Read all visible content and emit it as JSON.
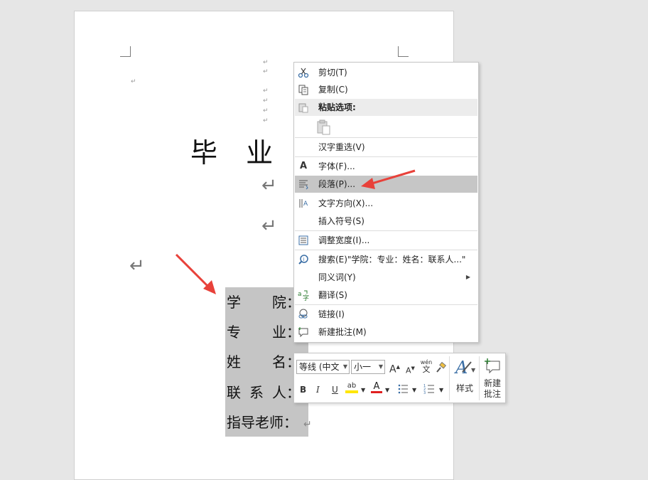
{
  "document": {
    "title": "毕 业 论",
    "return_mark": "↵",
    "fields": [
      {
        "label": "学院",
        "sep": "："
      },
      {
        "label": "专业",
        "sep": "："
      },
      {
        "label": "姓名",
        "sep": "："
      },
      {
        "label": "联系人",
        "sep": "："
      },
      {
        "label": "指导老师",
        "sep": "："
      }
    ]
  },
  "context_menu": {
    "items": [
      {
        "label": "剪切(T)",
        "icon": "scissors-icon"
      },
      {
        "label": "复制(C)",
        "icon": "copy-icon"
      },
      {
        "label": "粘贴选项:",
        "icon": "paste-icon"
      },
      {
        "label": "汉字重选(V)",
        "icon": ""
      },
      {
        "label": "字体(F)...",
        "icon": "font-icon"
      },
      {
        "label": "段落(P)...",
        "icon": "paragraph-icon"
      },
      {
        "label": "文字方向(X)...",
        "icon": "text-direction-icon"
      },
      {
        "label": "插入符号(S)",
        "icon": ""
      },
      {
        "label": "调整宽度(I)...",
        "icon": "adjust-width-icon"
      },
      {
        "label": "搜索(E)\"学院：专业：姓名：联系人...\"",
        "icon": "search-icon"
      },
      {
        "label": "同义词(Y)",
        "icon": ""
      },
      {
        "label": "翻译(S)",
        "icon": "translate-icon"
      },
      {
        "label": "链接(I)",
        "icon": "link-icon"
      },
      {
        "label": "新建批注(M)",
        "icon": "comment-icon"
      }
    ],
    "highlighted": "段落(P)..."
  },
  "mini_toolbar": {
    "font_name": "等线 (中文",
    "font_size": "小一",
    "grow_font": "A",
    "shrink_font": "A",
    "phonetic_top": "wén",
    "phonetic_bottom": "文",
    "bold": "B",
    "italic": "I",
    "underline": "U",
    "highlight": "ab",
    "font_color": "A",
    "styles_label": "样式",
    "new_comment_label_1": "新建",
    "new_comment_label_2": "批注"
  },
  "colors": {
    "annotation_arrow": "#e8413a",
    "highlight_yellow": "#ffe600",
    "font_color_red": "#e02020"
  }
}
